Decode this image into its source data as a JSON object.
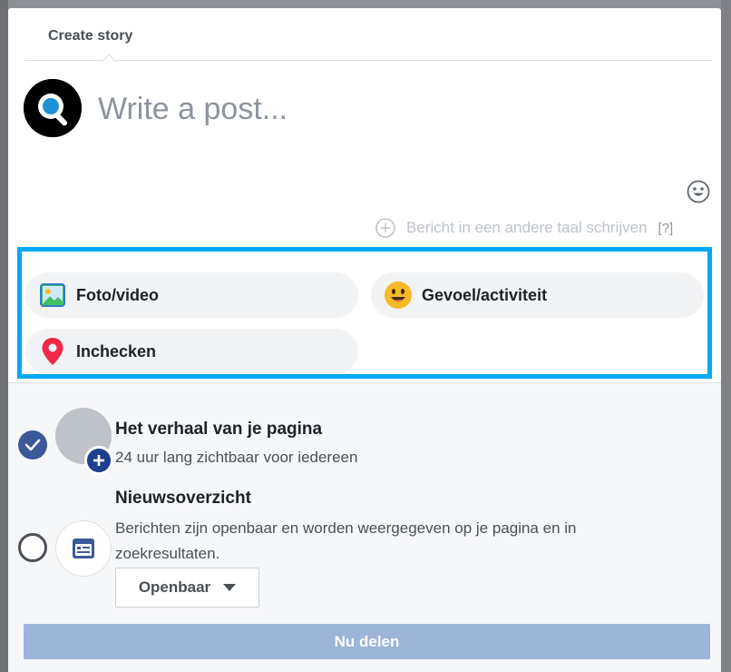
{
  "dialog": {
    "tab_title": "Create story",
    "composer": {
      "placeholder": "Write a post...",
      "avatar_icon": "magnifier-logo-icon",
      "emoji_icon": "smiley-icon"
    },
    "translate": {
      "label": "Bericht in een andere taal schrijven",
      "help": "[?]"
    },
    "actions": [
      {
        "label": "Foto/video",
        "icon": "photo-icon"
      },
      {
        "label": "Gevoel/activiteit",
        "icon": "emoji-feeling-icon"
      },
      {
        "label": "Inchecken",
        "icon": "location-pin-icon"
      }
    ],
    "destinations": {
      "story": {
        "title": "Het verhaal van je pagina",
        "subtitle": "24 uur lang zichtbaar voor iedereen",
        "checked": true
      },
      "feed": {
        "title": "Nieuwsoverzicht",
        "subtitle": "Berichten zijn openbaar en worden weergegeven op je pagina en in zoekresultaten.",
        "checked": false,
        "audience": "Openbaar"
      }
    },
    "share_label": "Nu delen"
  },
  "colors": {
    "highlight_border": "#03a9f4",
    "brand_blue": "#3b5998",
    "share_button": "#9cb4d8"
  }
}
